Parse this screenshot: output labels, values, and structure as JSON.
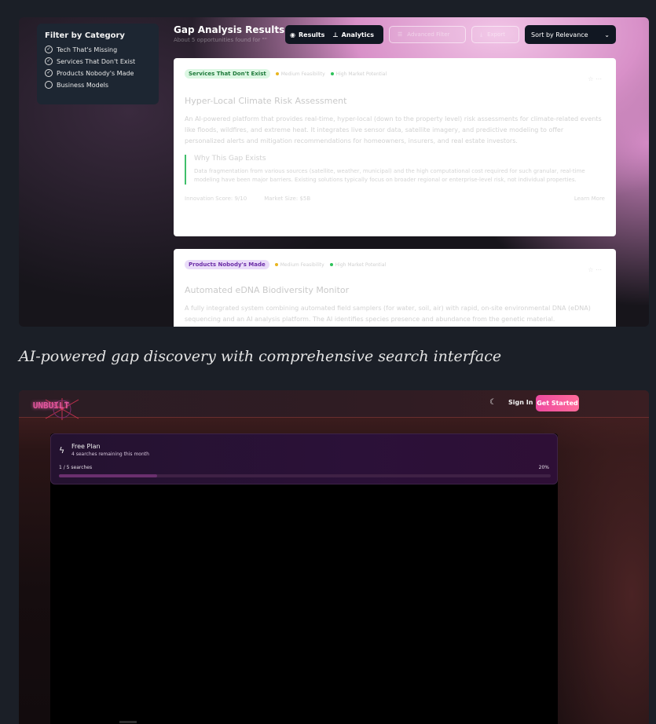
{
  "shot1": {
    "filter_panel": {
      "title": "Filter by Category",
      "items": [
        {
          "label": "Tech That's Missing",
          "checked": true
        },
        {
          "label": "Services That Don't Exist",
          "checked": true
        },
        {
          "label": "Products Nobody's Made",
          "checked": true
        },
        {
          "label": "Business Models",
          "checked": false
        }
      ]
    },
    "header": {
      "title": "Gap Analysis Results",
      "subtitle": "About 5 opportunities found for \"\""
    },
    "toggles": {
      "results": "Results",
      "analytics": "Analytics"
    },
    "buttons": {
      "advanced_filter": "Advanced Filter",
      "export": "Export"
    },
    "sort": {
      "selected": "Sort by Relevance"
    },
    "cards": [
      {
        "tag": "Services That Don't Exist",
        "feasibility": "Medium Feasibility",
        "market": "High Market Potential",
        "title": "Hyper-Local Climate Risk Assessment",
        "description": "An AI-powered platform that provides real-time, hyper-local (down to the property level) risk assessments for climate-related events like floods, wildfires, and extreme heat. It integrates live sensor data, satellite imagery, and predictive modeling to offer personalized alerts and mitigation recommendations for homeowners, insurers, and real estate investors.",
        "why_title": "Why This Gap Exists",
        "why_text": "Data fragmentation from various sources (satellite, weather, municipal) and the high computational cost required for such granular, real-time modeling have been major barriers. Existing solutions typically focus on broader regional or enterprise-level risk, not individual properties.",
        "innovation": "Innovation Score: 9/10",
        "market_size": "Market Size: $5B",
        "learn_more": "Learn More"
      },
      {
        "tag": "Products Nobody's Made",
        "feasibility": "Medium Feasibility",
        "market": "High Market Potential",
        "title": "Automated eDNA Biodiversity Monitor",
        "description": "A fully integrated system combining automated field samplers (for water, soil, air) with rapid, on-site environmental DNA (eDNA) sequencing and an AI analysis platform. The AI identifies species presence and abundance from the genetic material."
      }
    ],
    "colors": {
      "dot_medium": "#e8b51f",
      "dot_high": "#2ec25a",
      "accent_green": "#3fbf6a"
    }
  },
  "caption": "AI-powered gap discovery with comprehensive search interface",
  "shot2": {
    "nav": {
      "logo_text": "UNBUILT",
      "theme_icon": "moon-icon",
      "sign_in": "Sign In",
      "get_started": "Get Started"
    },
    "plan": {
      "name": "Free Plan",
      "remaining": "4 searches remaining this month",
      "count": "1 / 5 searches",
      "percent_label": "20%",
      "progress": 0.2
    },
    "colors": {
      "cta_start": "#ee4aa0",
      "cta_end": "#ff6b9a",
      "progress": "#6a2f6e"
    }
  }
}
